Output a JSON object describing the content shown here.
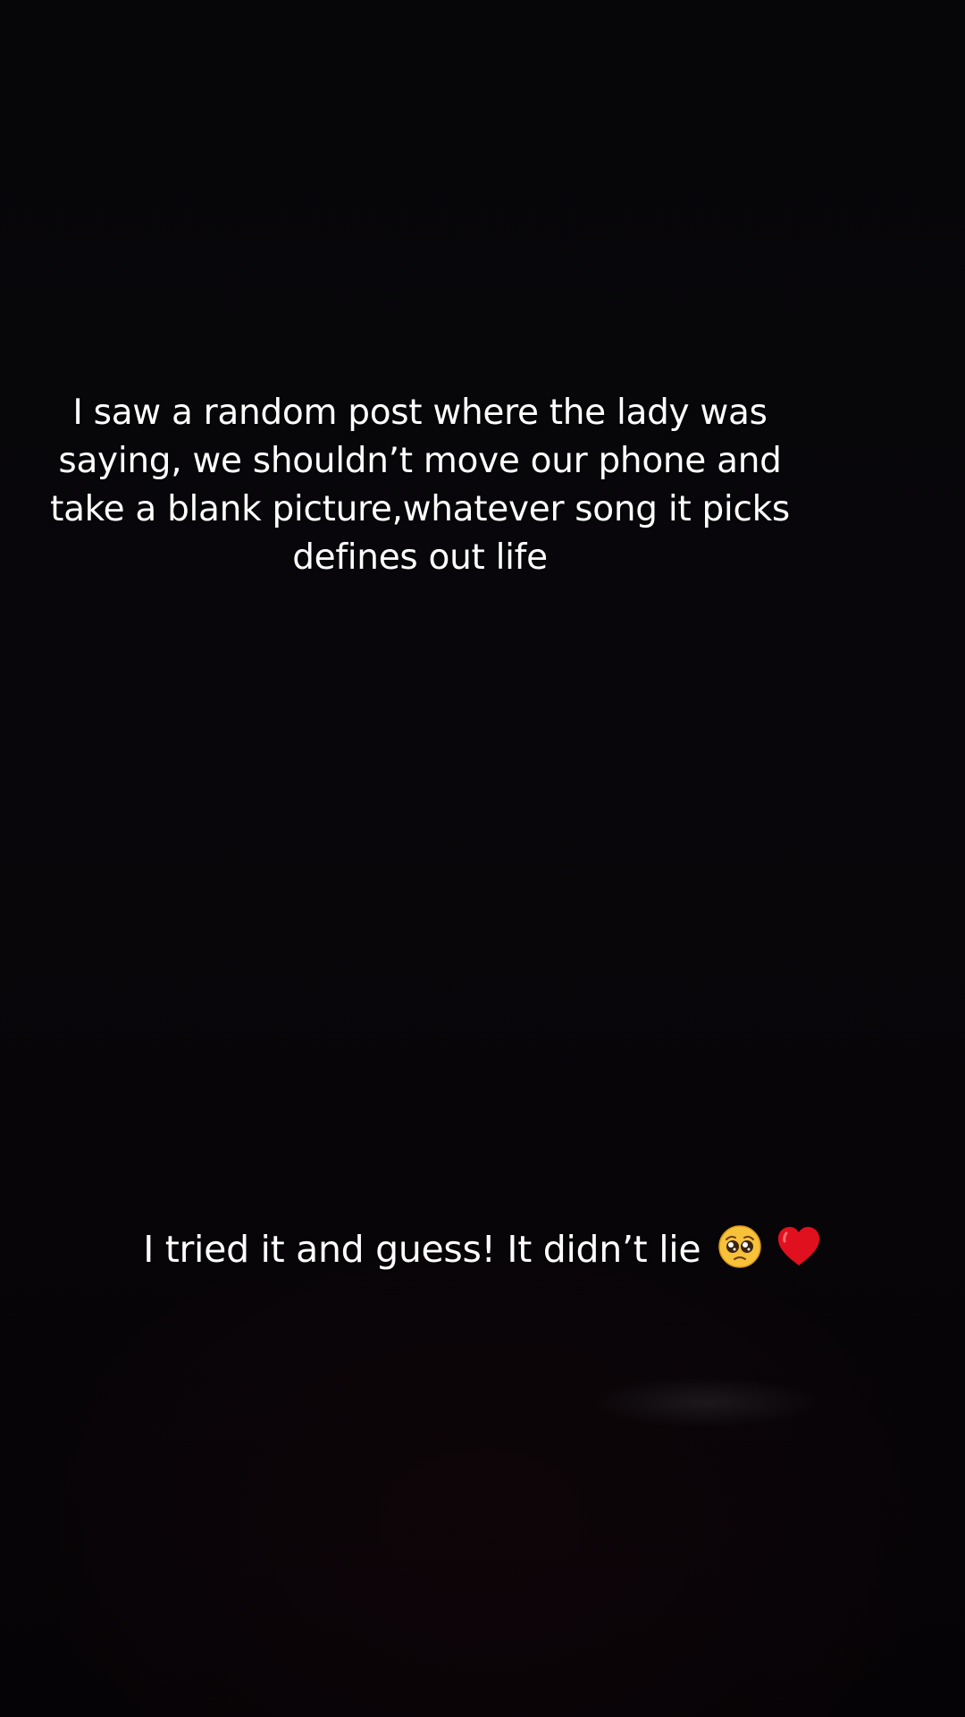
{
  "story": {
    "caption_top": "I saw a random post where the lady was saying, we shouldn’t move our phone and take a blank picture,whatever song it picks defines out life",
    "caption_bottom": "I tried it and guess! It didn’t lie",
    "emojis": [
      "pleading-face-icon",
      "red-heart-icon"
    ],
    "colors": {
      "background": "#060508",
      "text": "#ffffff",
      "heart": "#e0101e",
      "face": "#f7c23a"
    }
  }
}
